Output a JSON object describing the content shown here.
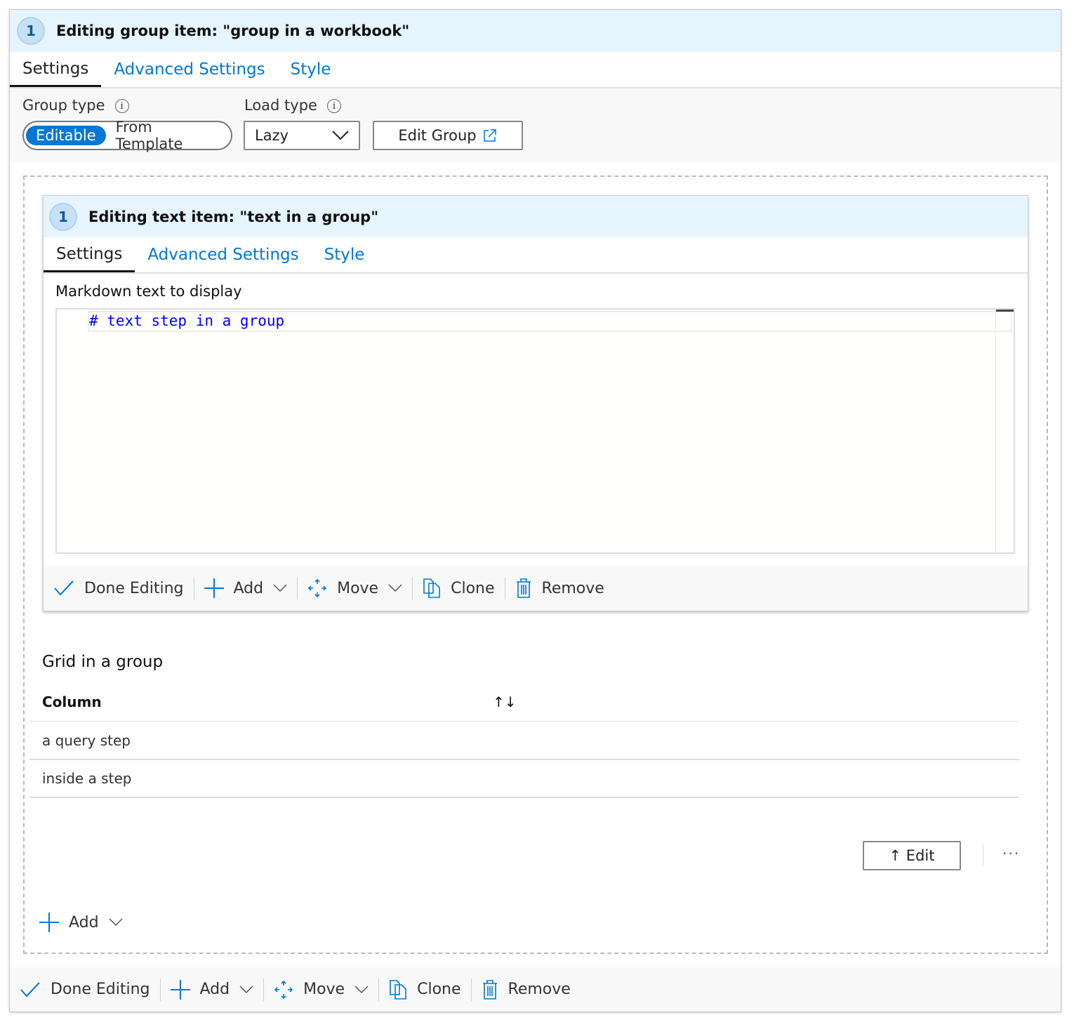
{
  "group": {
    "badge": "1",
    "title": "Editing group item: \"group in a workbook\"",
    "tabs": [
      "Settings",
      "Advanced Settings",
      "Style"
    ],
    "group_type_label": "Group type",
    "group_type_options": [
      "Editable",
      "From Template"
    ],
    "group_type_selected": "Editable",
    "load_type_label": "Load type",
    "load_type_value": "Lazy",
    "edit_group_label": "Edit Group"
  },
  "text_item": {
    "badge": "1",
    "title": "Editing text item: \"text in a group\"",
    "tabs": [
      "Settings",
      "Advanced Settings",
      "Style"
    ],
    "markdown_label": "Markdown text to display",
    "markdown_value": "# text step in a group"
  },
  "inner_toolbar": {
    "done": "Done Editing",
    "add": "Add",
    "move": "Move",
    "clone": "Clone",
    "remove": "Remove"
  },
  "grid": {
    "title": "Grid in a group",
    "column_header": "Column",
    "rows": [
      "a query step",
      "inside a step"
    ],
    "edit_label": "↑ Edit",
    "more_label": "···"
  },
  "add_label": "Add",
  "outer_toolbar": {
    "done": "Done Editing",
    "add": "Add",
    "move": "Move",
    "clone": "Clone",
    "remove": "Remove"
  },
  "colors": {
    "accent": "#0078d4",
    "header_bg": "#e6f4fe",
    "toolbar_bg": "#f8f8f8"
  }
}
